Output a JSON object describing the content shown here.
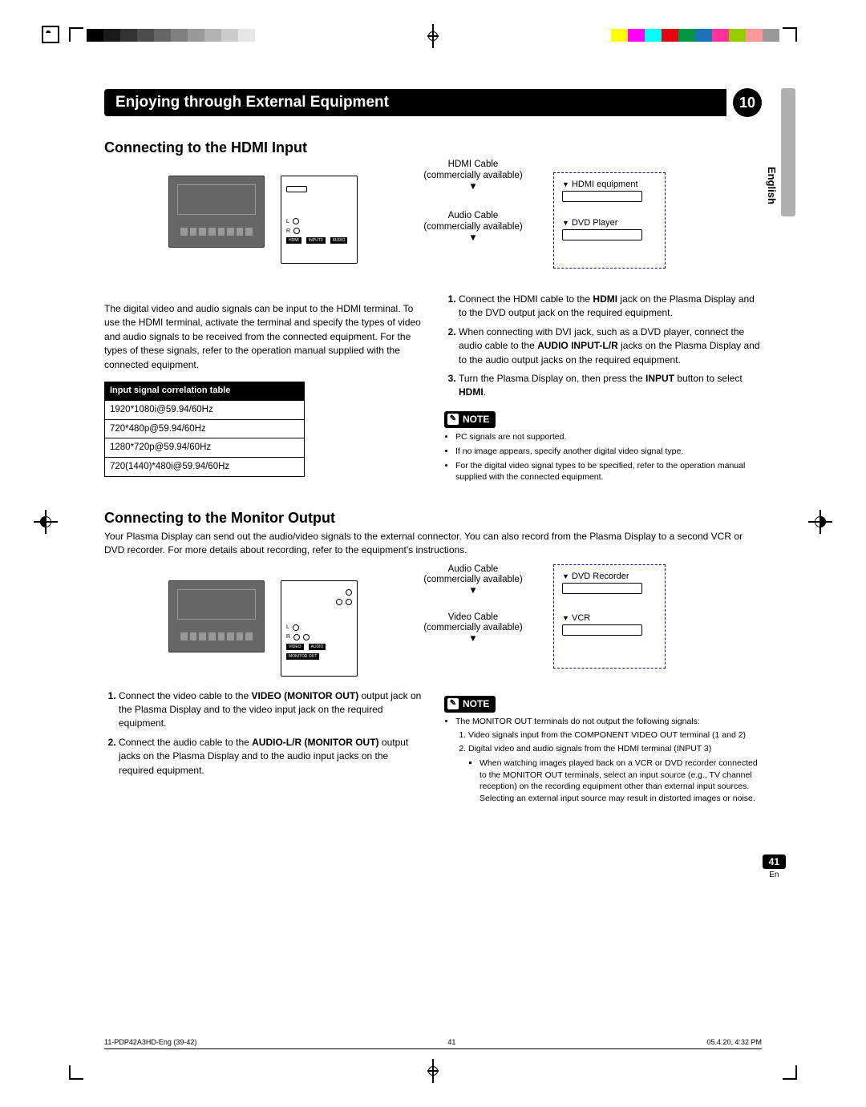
{
  "chapter": {
    "title": "Enjoying through External Equipment",
    "number": "10"
  },
  "language_tab": "English",
  "section1": {
    "heading": "Connecting to the HDMI Input",
    "diagram": {
      "hdmi_cable": "HDMI Cable",
      "hdmi_cable_sub": "(commercially available)",
      "audio_cable": "Audio Cable",
      "audio_cable_sub": "(commercially available)",
      "hdmi_equipment": "HDMI equipment",
      "dvd_player": "DVD Player",
      "panel": {
        "l": "L",
        "r": "R",
        "hdmi": "HDMI",
        "input3": "INPUT3",
        "audio": "AUDIO"
      }
    },
    "left_para": "The digital video and audio signals can be input to the HDMI terminal. To use the HDMI terminal, activate the terminal and specify the types of video and audio signals to be received from the connected equipment. For the types of these signals, refer to the operation manual supplied with the connected equipment.",
    "table": {
      "header": "Input signal correlation table",
      "rows": [
        "1920*1080i@59.94/60Hz",
        "720*480p@59.94/60Hz",
        "1280*720p@59.94/60Hz",
        "720(1440)*480i@59.94/60Hz"
      ]
    },
    "steps": {
      "s1_pre": "Connect the HDMI cable to the ",
      "s1_b": "HDMI",
      "s1_post": " jack on the Plasma Display and to the DVD output jack on the required equipment.",
      "s2_pre": "When connecting with DVI jack, such as a DVD player, connect the audio cable to the ",
      "s2_b": "AUDIO INPUT-L/R",
      "s2_post": " jacks on the Plasma Display and to the audio output jacks on the required equipment.",
      "s3_pre": "Turn the Plasma Display on, then press the ",
      "s3_b1": "INPUT",
      "s3_mid": " button to select ",
      "s3_b2": "HDMI",
      "s3_post": "."
    },
    "note_label": "NOTE",
    "notes": [
      "PC signals are not supported.",
      "If no image appears, specify another digital video signal type.",
      "For the digital video signal types to be specified, refer to the operation manual supplied with the connected equipment."
    ]
  },
  "section2": {
    "heading": "Connecting to the Monitor Output",
    "intro": "Your Plasma Display can send out the audio/video signals to the external connector. You can also record from the Plasma Display to a second VCR or DVD recorder. For more details about recording, refer to the equipment's instructions.",
    "diagram": {
      "audio_cable": "Audio Cable",
      "audio_cable_sub": "(commercially available)",
      "video_cable": "Video Cable",
      "video_cable_sub": "(commercially available)",
      "dvd_recorder": "DVD Recorder",
      "vcr": "VCR",
      "panel": {
        "l": "L",
        "r": "R",
        "video": "VIDEO",
        "audio": "AUDIO",
        "monitor_out": "MONITOR OUT"
      }
    },
    "steps": {
      "s1_pre": "Connect the video cable to the ",
      "s1_b": "VIDEO (MONITOR OUT)",
      "s1_post": " output jack on the Plasma Display and to the video input jack on the required equipment.",
      "s2_pre": "Connect the audio cable to the ",
      "s2_b": "AUDIO-L/R (MONITOR OUT)",
      "s2_post": " output jacks on the Plasma Display and to the audio input jacks on the required equipment."
    },
    "note_label": "NOTE",
    "note_intro": "The MONITOR OUT terminals do not output the following signals:",
    "note_sub": [
      "Video signals input from the COMPONENT VIDEO OUT terminal (1 and 2)",
      "Digital video and audio signals from the HDMI terminal (INPUT 3)"
    ],
    "note_bullet": "When watching images played back on a VCR or DVD recorder connected to the MONITOR OUT terminals, select an input source (e.g., TV channel reception) on the recording equipment other than external input sources. Selecting an external input source may result in distorted images or noise."
  },
  "page_footer": {
    "page_badge": "41",
    "en": "En"
  },
  "footer_meta": {
    "file": "11-PDP42A3HD-Eng (39-42)",
    "page": "41",
    "timestamp": "05.4.20, 4:32 PM"
  }
}
